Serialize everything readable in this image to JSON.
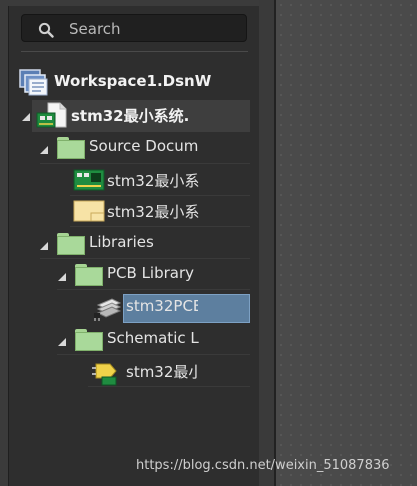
{
  "search": {
    "placeholder": "Search"
  },
  "tree": {
    "workspace": "Workspace1.DsnW",
    "project": "stm32最小系统.",
    "source_folder": "Source Docum",
    "source_files": [
      "stm32最小系",
      "stm32最小系"
    ],
    "libraries": "Libraries",
    "pcb_library": "PCB Library",
    "pcb_library_file": "stm32PCE",
    "schematic_library": "Schematic L",
    "schematic_library_file": "stm32最小"
  },
  "watermark": "https://blog.csdn.net/weixin_51087836",
  "colors": {
    "panel_bg": "#2e2e2e",
    "selection": "#5d7f9f",
    "folder": "#a9d99a"
  },
  "icons": [
    "search-icon",
    "workspace-icon",
    "project-icon",
    "folder-icon",
    "pcb-doc-icon",
    "schematic-doc-icon",
    "pcb-library-icon",
    "schematic-library-icon"
  ]
}
